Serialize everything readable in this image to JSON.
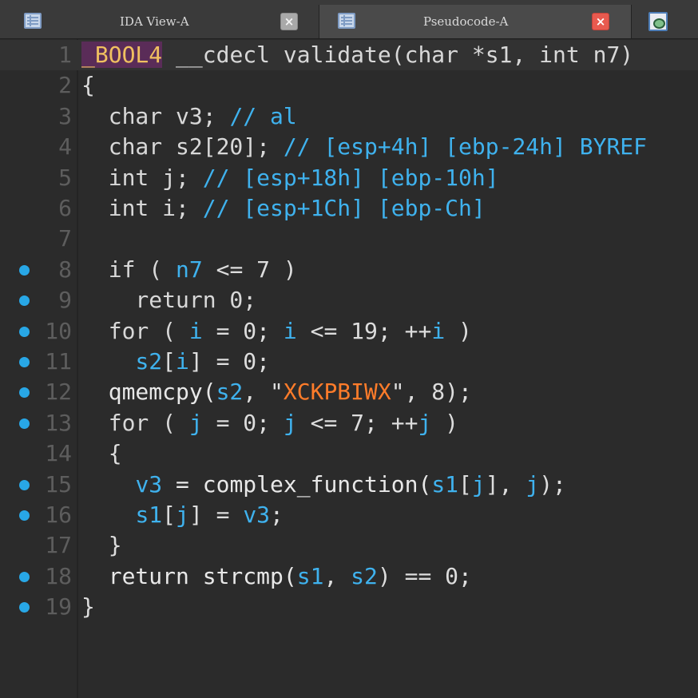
{
  "tabs": [
    {
      "label": "IDA View-A",
      "icon": "listing-icon",
      "close": "×",
      "active": false
    },
    {
      "label": "Pseudocode-A",
      "icon": "listing-icon",
      "close": "×",
      "active": true
    }
  ],
  "extra_tab_icon": "structures-icon",
  "colors": {
    "background": "#2b2b2b",
    "breakpoint": "#28a7e6",
    "identifier": "#3fb2ee",
    "string": "#ff7c2a",
    "type_highlight": "#5a2c58"
  },
  "lines": [
    {
      "n": "1",
      "bp": false,
      "tokens": [
        {
          "t": "_BOOL4",
          "c": "hl"
        },
        {
          "t": " __cdecl validate(char *s1, int n7)",
          "c": "kw"
        }
      ]
    },
    {
      "n": "2",
      "bp": false,
      "tokens": [
        {
          "t": "{",
          "c": "op"
        }
      ]
    },
    {
      "n": "3",
      "bp": false,
      "tokens": [
        {
          "t": "  char v3; ",
          "c": "kw"
        },
        {
          "t": "// al",
          "c": "cmt"
        }
      ]
    },
    {
      "n": "4",
      "bp": false,
      "tokens": [
        {
          "t": "  char s2[20]; ",
          "c": "kw"
        },
        {
          "t": "// [esp+4h] [ebp-24h] BYREF",
          "c": "cmt"
        }
      ]
    },
    {
      "n": "5",
      "bp": false,
      "tokens": [
        {
          "t": "  int j; ",
          "c": "kw"
        },
        {
          "t": "// [esp+18h] [ebp-10h]",
          "c": "cmt"
        }
      ]
    },
    {
      "n": "6",
      "bp": false,
      "tokens": [
        {
          "t": "  int i; ",
          "c": "kw"
        },
        {
          "t": "// [esp+1Ch] [ebp-Ch]",
          "c": "cmt"
        }
      ]
    },
    {
      "n": "7",
      "bp": false,
      "tokens": []
    },
    {
      "n": "8",
      "bp": true,
      "tokens": [
        {
          "t": "  if ( ",
          "c": "kw"
        },
        {
          "t": "n7",
          "c": "var"
        },
        {
          "t": " <= 7 )",
          "c": "op"
        }
      ]
    },
    {
      "n": "9",
      "bp": true,
      "tokens": [
        {
          "t": "    return 0;",
          "c": "kw"
        }
      ]
    },
    {
      "n": "10",
      "bp": true,
      "tokens": [
        {
          "t": "  for ( ",
          "c": "kw"
        },
        {
          "t": "i",
          "c": "var"
        },
        {
          "t": " = 0; ",
          "c": "op"
        },
        {
          "t": "i",
          "c": "var"
        },
        {
          "t": " <= 19; ++",
          "c": "op"
        },
        {
          "t": "i",
          "c": "var"
        },
        {
          "t": " )",
          "c": "op"
        }
      ]
    },
    {
      "n": "11",
      "bp": true,
      "tokens": [
        {
          "t": "    ",
          "c": "op"
        },
        {
          "t": "s2",
          "c": "var"
        },
        {
          "t": "[",
          "c": "op"
        },
        {
          "t": "i",
          "c": "var"
        },
        {
          "t": "] = 0;",
          "c": "op"
        }
      ]
    },
    {
      "n": "12",
      "bp": true,
      "tokens": [
        {
          "t": "  qmemcpy(",
          "c": "fn"
        },
        {
          "t": "s2",
          "c": "var"
        },
        {
          "t": ", \"",
          "c": "op"
        },
        {
          "t": "XCKPBIWX",
          "c": "str"
        },
        {
          "t": "\", 8);",
          "c": "op"
        }
      ]
    },
    {
      "n": "13",
      "bp": true,
      "tokens": [
        {
          "t": "  for ( ",
          "c": "kw"
        },
        {
          "t": "j",
          "c": "var"
        },
        {
          "t": " = 0; ",
          "c": "op"
        },
        {
          "t": "j",
          "c": "var"
        },
        {
          "t": " <= 7; ++",
          "c": "op"
        },
        {
          "t": "j",
          "c": "var"
        },
        {
          "t": " )",
          "c": "op"
        }
      ]
    },
    {
      "n": "14",
      "bp": false,
      "tokens": [
        {
          "t": "  {",
          "c": "op"
        }
      ]
    },
    {
      "n": "15",
      "bp": true,
      "tokens": [
        {
          "t": "    ",
          "c": "op"
        },
        {
          "t": "v3",
          "c": "var"
        },
        {
          "t": " = complex_function(",
          "c": "fn"
        },
        {
          "t": "s1",
          "c": "var"
        },
        {
          "t": "[",
          "c": "op"
        },
        {
          "t": "j",
          "c": "var"
        },
        {
          "t": "], ",
          "c": "op"
        },
        {
          "t": "j",
          "c": "var"
        },
        {
          "t": ");",
          "c": "op"
        }
      ]
    },
    {
      "n": "16",
      "bp": true,
      "tokens": [
        {
          "t": "    ",
          "c": "op"
        },
        {
          "t": "s1",
          "c": "var"
        },
        {
          "t": "[",
          "c": "op"
        },
        {
          "t": "j",
          "c": "var"
        },
        {
          "t": "] = ",
          "c": "op"
        },
        {
          "t": "v3",
          "c": "var"
        },
        {
          "t": ";",
          "c": "op"
        }
      ]
    },
    {
      "n": "17",
      "bp": false,
      "tokens": [
        {
          "t": "  }",
          "c": "op"
        }
      ]
    },
    {
      "n": "18",
      "bp": true,
      "tokens": [
        {
          "t": "  return strcmp(",
          "c": "fn"
        },
        {
          "t": "s1",
          "c": "var"
        },
        {
          "t": ", ",
          "c": "op"
        },
        {
          "t": "s2",
          "c": "var"
        },
        {
          "t": ") == 0;",
          "c": "op"
        }
      ]
    },
    {
      "n": "19",
      "bp": true,
      "tokens": [
        {
          "t": "}",
          "c": "op"
        }
      ]
    }
  ]
}
